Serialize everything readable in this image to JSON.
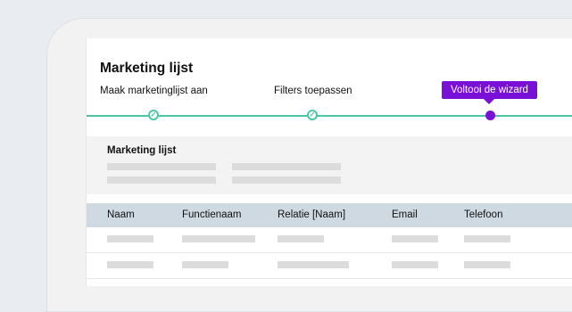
{
  "header": {
    "title": "Marketing lijst"
  },
  "wizard": {
    "steps": [
      {
        "label": "Maak marketinglijst aan",
        "status": "completed"
      },
      {
        "label": "Filters toepassen",
        "status": "completed"
      },
      {
        "label": "Voltooi de wizard",
        "status": "active"
      }
    ],
    "colors": {
      "completed": "#4cc6a4",
      "active": "#7a10d8"
    }
  },
  "section": {
    "title": "Marketing lijst"
  },
  "table": {
    "columns": [
      "Naam",
      "Functienaam",
      "Relatie [Naam]",
      "Email",
      "Telefoon"
    ]
  }
}
